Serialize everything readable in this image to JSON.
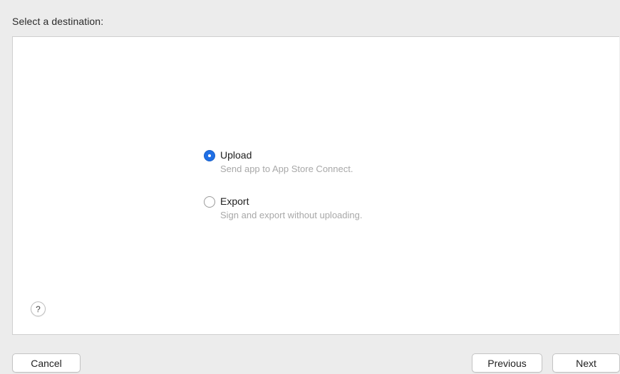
{
  "header": {
    "label": "Select a destination:"
  },
  "options": [
    {
      "title": "Upload",
      "description": "Send app to App Store Connect.",
      "selected": true
    },
    {
      "title": "Export",
      "description": "Sign and export without uploading.",
      "selected": false
    }
  ],
  "help": {
    "label": "?"
  },
  "footer": {
    "cancel_label": "Cancel",
    "previous_label": "Previous",
    "next_label": "Next"
  },
  "colors": {
    "accent": "#1f6fe5",
    "background": "#ececec",
    "panel": "#ffffff",
    "description_text": "#a8a8a8"
  }
}
